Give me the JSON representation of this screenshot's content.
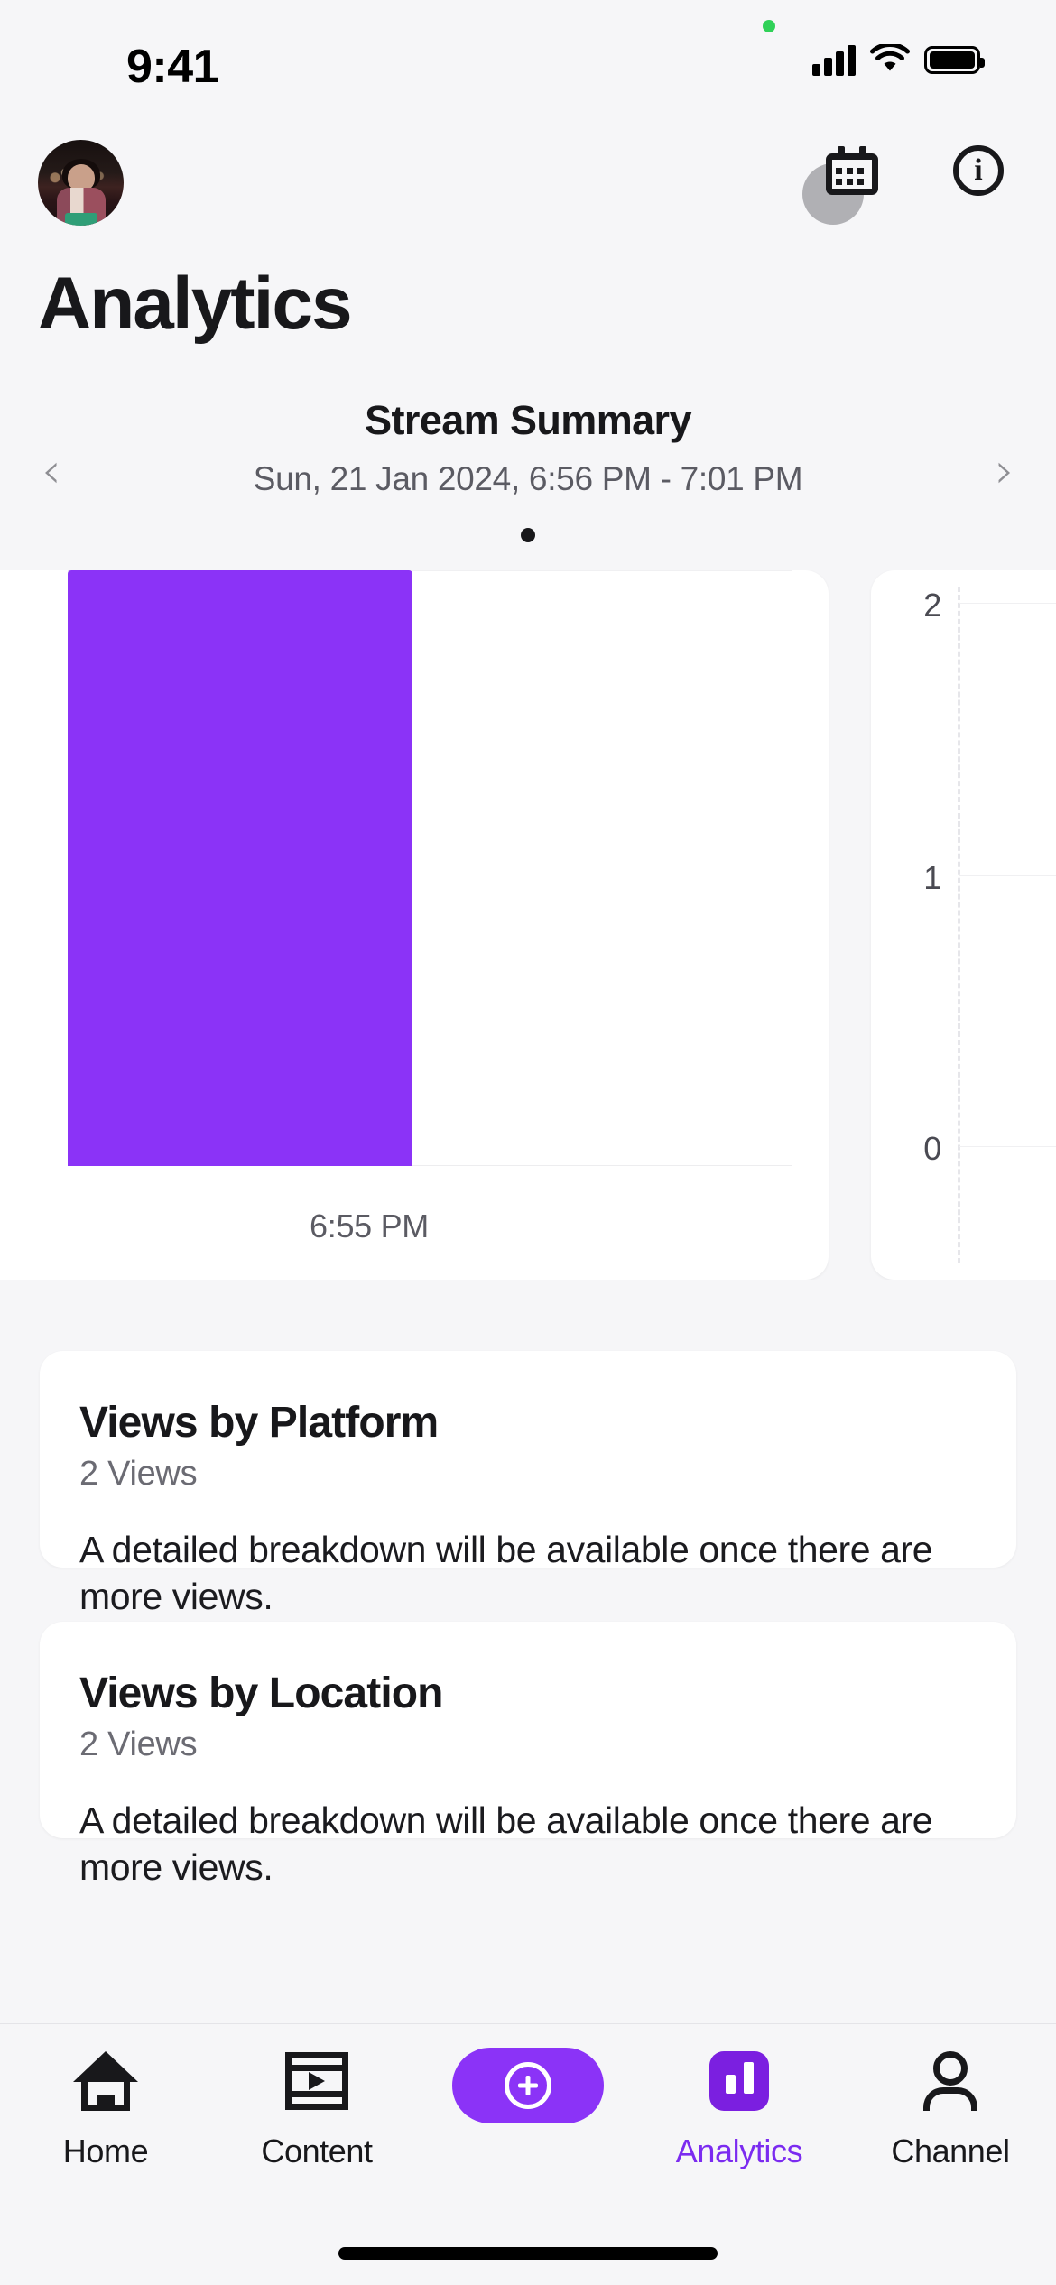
{
  "status_bar": {
    "time": "9:41",
    "recording_dot": "green-recording-dot",
    "cellular": "cellular-bars-icon",
    "wifi": "wifi-icon",
    "battery": "battery-full-icon"
  },
  "header": {
    "avatar": "user-avatar",
    "calendar_button": "calendar-icon",
    "info_button": "info-icon"
  },
  "page": {
    "title": "Analytics"
  },
  "summary": {
    "title": "Stream Summary",
    "date_range": "Sun, 21 Jan 2024, 6:56 PM - 7:01 PM",
    "prev_label": "‹",
    "next_label": "›",
    "page_index": 1,
    "page_count": 1
  },
  "chart_data": [
    {
      "type": "bar",
      "title": "",
      "categories": [
        "6:55 PM"
      ],
      "values": [
        2
      ],
      "xlabel": "",
      "ylabel": "",
      "ylim": [
        0,
        2
      ],
      "grid": true,
      "legend": "none",
      "bar_color": "#8B33F7",
      "tick_labels": [
        "6:55 PM"
      ]
    },
    {
      "type": "bar",
      "title": "",
      "categories": [],
      "values": [],
      "xlabel": "",
      "ylabel": "",
      "ylim": [
        0,
        2
      ],
      "yticks": [
        "2",
        "1",
        "0"
      ],
      "grid": true,
      "legend": "none",
      "bar_color": "#8B33F7"
    }
  ],
  "cards": [
    {
      "title": "Views by Platform",
      "subtitle": "2 Views",
      "body": "A detailed breakdown will be available once there are more views."
    },
    {
      "title": "Views by Location",
      "subtitle": "2 Views",
      "body": "A detailed breakdown will be available once there are more views."
    }
  ],
  "tabbar": {
    "items": [
      {
        "label": "Home",
        "icon": "home-icon",
        "active": false
      },
      {
        "label": "Content",
        "icon": "film-play-icon",
        "active": false
      },
      {
        "label": "",
        "icon": "add-plus-icon",
        "active": false
      },
      {
        "label": "Analytics",
        "icon": "bar-chart-icon",
        "active": true
      },
      {
        "label": "Channel",
        "icon": "person-icon",
        "active": false
      }
    ]
  },
  "colors": {
    "accent": "#8B33F7",
    "accent_dark": "#7B1FE0",
    "accent_text": "#7B2BF0",
    "background": "#F6F6F8",
    "card": "#FFFFFF",
    "text": "#18181B",
    "muted": "#6B6B73",
    "recording": "#30D158"
  }
}
